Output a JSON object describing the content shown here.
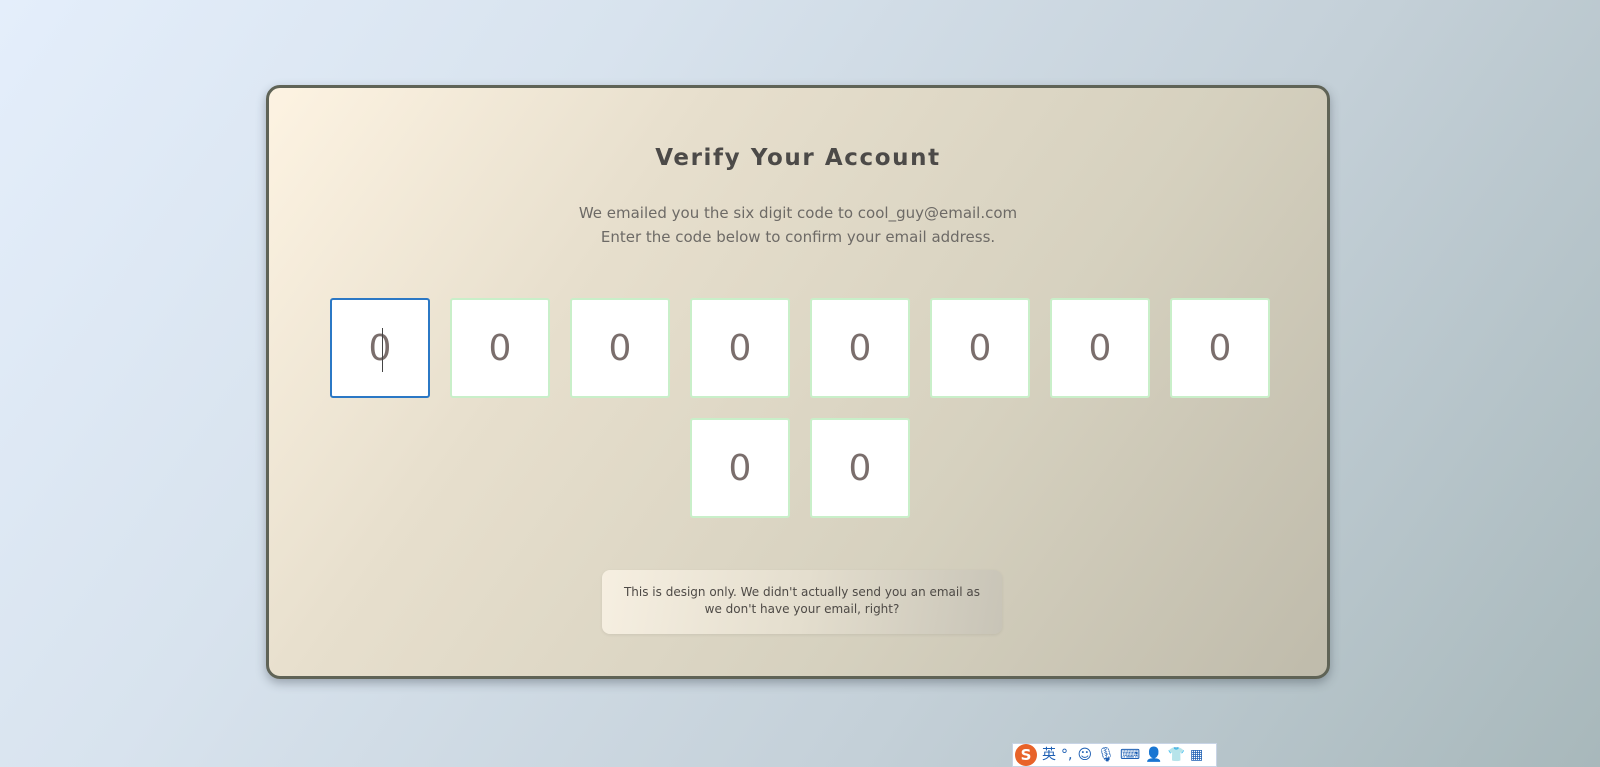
{
  "verify": {
    "title": "Verify Your Account",
    "subtitle_line1": "We emailed you the six digit code to cool_guy@email.com",
    "subtitle_line2": "Enter the code below to confirm your email address.",
    "code_digits": [
      "0",
      "0",
      "0",
      "0",
      "0",
      "0",
      "0",
      "0",
      "0",
      "0"
    ],
    "active_index": 0,
    "note": "This is design only. We didn't actually send you an email as we don't have your email, right?"
  },
  "ime_toolbar": {
    "logo": "S",
    "mode_label": "英",
    "items": [
      {
        "icon": "punctuation-icon",
        "glyph": "°,"
      },
      {
        "icon": "emoji-icon",
        "glyph": "☺"
      },
      {
        "icon": "microphone-icon",
        "glyph": "🎙"
      },
      {
        "icon": "keyboard-icon",
        "glyph": "⌨"
      },
      {
        "icon": "user-tools-icon",
        "glyph": "👤"
      },
      {
        "icon": "skin-shirt-icon",
        "glyph": "👕"
      },
      {
        "icon": "grid-menu-icon",
        "glyph": "▦"
      }
    ]
  },
  "colors": {
    "active_border": "#2b78c5",
    "box_border": "#c9efc9",
    "ime_logo": "#e8632a"
  }
}
